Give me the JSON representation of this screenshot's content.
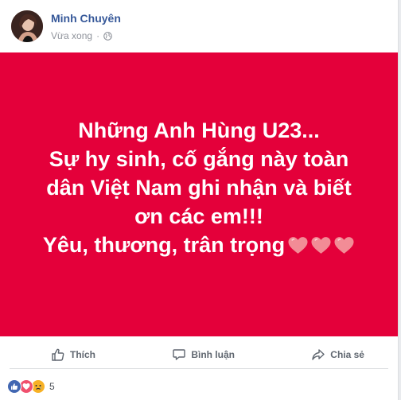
{
  "post": {
    "author": "Minh Chuyên",
    "timestamp": "Vừa xong",
    "privacy_icon": "globe-icon",
    "background_color": "#e4003a",
    "text_lines": [
      "Những Anh Hùng U23...",
      "Sự hy sinh, cố gắng này toàn",
      "dân Việt Nam ghi nhận và biết",
      "ơn các em!!!",
      "Yêu, thương, trân trọng"
    ],
    "trailing_emoji": [
      "heart-icon",
      "heart-icon",
      "heart-icon"
    ]
  },
  "actions": {
    "like_label": "Thích",
    "comment_label": "Bình luận",
    "share_label": "Chia sẻ"
  },
  "reactions": {
    "icons": [
      "like-reaction-icon",
      "love-reaction-icon",
      "sad-reaction-icon"
    ],
    "count": "5"
  },
  "colors": {
    "link": "#365899",
    "muted": "#90949c",
    "like_blue": "#4267b2",
    "love_red": "#f0506e",
    "sad_yellow": "#f7b125"
  }
}
